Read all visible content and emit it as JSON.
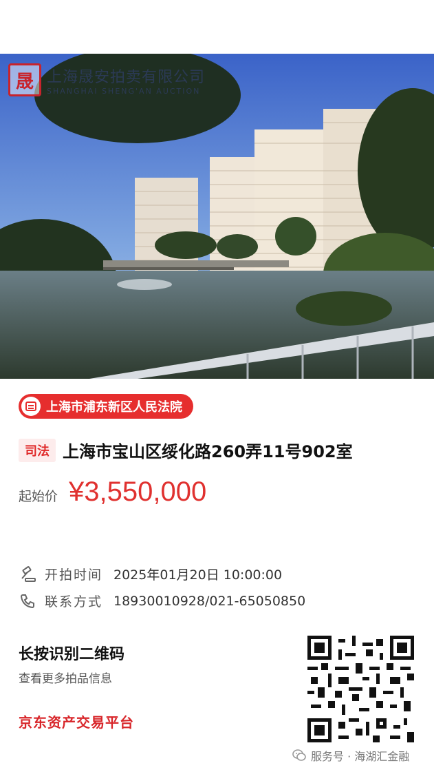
{
  "watermark": {
    "brand_cn": "上海晟安拍卖有限公司",
    "brand_en": "SHANGHAI SHENG'AN AUCTION"
  },
  "court": {
    "label": "上海市浦东新区人民法院"
  },
  "listing": {
    "tag": "司法",
    "address": "上海市宝山区绥化路260弄11号902室",
    "price_label": "起始价",
    "price": "¥3,550,000"
  },
  "info": {
    "start_label": "开拍时间",
    "start_value": "2025年01月20日 10:00:00",
    "contact_label": "联系方式",
    "contact_value": "18930010928/021-65050850"
  },
  "qr_block": {
    "title": "长按识别二维码",
    "subtitle": "查看更多拍品信息",
    "platform": "京东资产交易平台"
  },
  "footer": {
    "text": "服务号 · 海湖汇金融"
  },
  "colors": {
    "accent": "#e62e2e",
    "price": "#e0312f",
    "platform": "#d8262a"
  },
  "icons": [
    "seal-logo-icon",
    "court-icon",
    "gavel-icon",
    "phone-icon",
    "qr-code-icon",
    "wechat-icon"
  ]
}
